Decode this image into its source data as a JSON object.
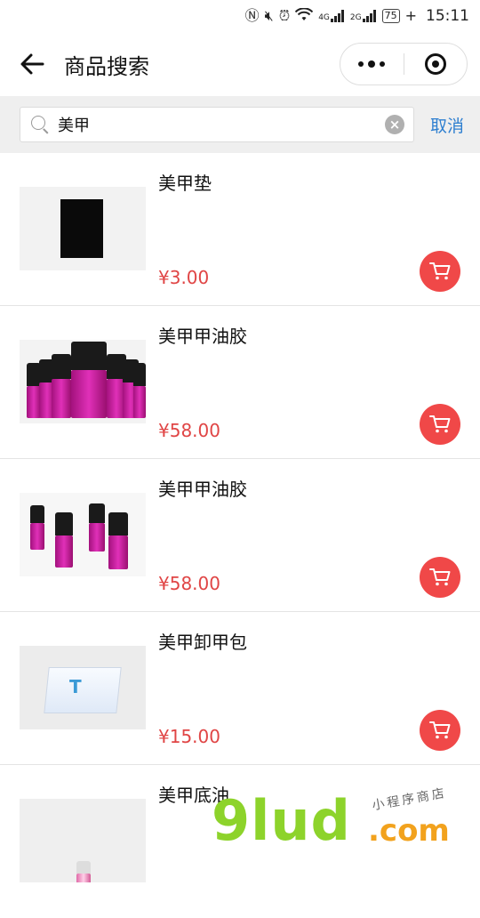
{
  "status_bar": {
    "icons": [
      "nfc-icon",
      "mute-icon",
      "alarm-icon",
      "wifi-icon",
      "signal-4g-icon",
      "signal-2g-icon"
    ],
    "net1": "4G",
    "net2": "2G",
    "battery": "75",
    "time": "15:11"
  },
  "nav": {
    "title": "商品搜索"
  },
  "search": {
    "value": "美甲",
    "cancel_label": "取消"
  },
  "products": [
    {
      "name": "美甲垫",
      "price": "¥3.00",
      "image": "nail-pad"
    },
    {
      "name": "美甲甲油胶",
      "price": "¥58.00",
      "image": "gel-polish-bottles"
    },
    {
      "name": "美甲甲油胶",
      "price": "¥58.00",
      "image": "gel-polish-bottles"
    },
    {
      "name": "美甲卸甲包",
      "price": "¥15.00",
      "image": "remover-pack"
    },
    {
      "name": "美甲底油",
      "price": "",
      "image": "base-coat-bottle"
    }
  ],
  "watermark": {
    "main": "9lud",
    "domain": ".com",
    "tagline": "小程序商店"
  },
  "colors": {
    "price": "#e04545",
    "cart_button": "#f04848",
    "cancel_link": "#2e7fd0"
  }
}
